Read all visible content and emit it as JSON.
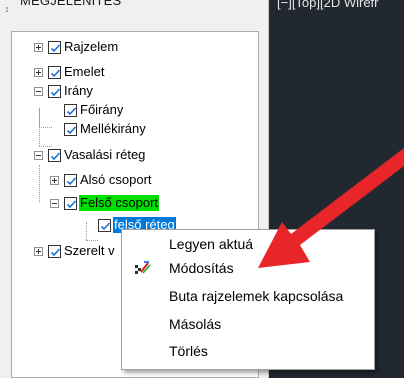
{
  "panel": {
    "title": "MEGJELENÍTÉS"
  },
  "viewport": {
    "label": "[−][Top][2D Wirefr"
  },
  "tree": {
    "items": [
      {
        "label": "Rajzelem",
        "checked": true,
        "expander": "plus"
      },
      {
        "label": "Emelet",
        "checked": true,
        "expander": "plus"
      },
      {
        "label": "Irány",
        "checked": true,
        "expander": "minus"
      },
      {
        "label": "Főirány",
        "checked": true,
        "expander": "none"
      },
      {
        "label": "Mellékirány",
        "checked": true,
        "expander": "none"
      },
      {
        "label": "Vasalási réteg",
        "checked": true,
        "expander": "minus"
      },
      {
        "label": "Alsó csoport",
        "checked": true,
        "expander": "plus"
      },
      {
        "label": "Felső csoport",
        "checked": true,
        "expander": "minus",
        "highlight": "#00e000"
      },
      {
        "label": "felső réteg",
        "checked": true,
        "expander": "none",
        "selected": true
      },
      {
        "label": "Szerelt v",
        "checked": true,
        "expander": "plus"
      }
    ]
  },
  "context_menu": {
    "items": [
      {
        "label": "Legyen aktuá",
        "icon": ""
      },
      {
        "label": "Módosítás",
        "icon": "modify-icon"
      },
      {
        "label": "Buta rajzelemek kapcsolása",
        "icon": ""
      },
      {
        "label": "Másolás",
        "icon": ""
      },
      {
        "label": "Törlés",
        "icon": ""
      }
    ]
  },
  "colors": {
    "highlight_green": "#00e000",
    "selection_blue": "#0078d7",
    "arrow_red": "#e8262a",
    "viewport_bg": "#212830"
  }
}
